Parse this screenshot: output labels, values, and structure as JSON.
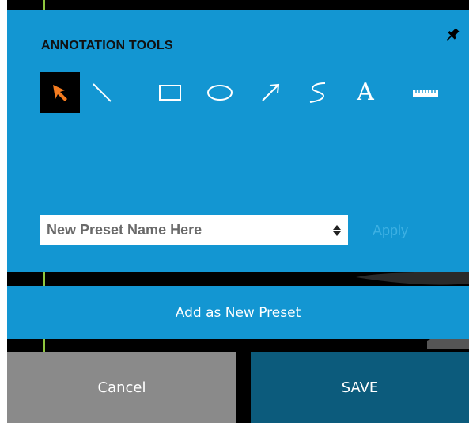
{
  "panel": {
    "title": "ANNOTATION TOOLS",
    "pin_icon": "pin-icon",
    "tools": [
      {
        "name": "pointer",
        "icon": "arrow-pointer-icon",
        "active": true
      },
      {
        "name": "line",
        "icon": "line-icon",
        "active": false
      },
      {
        "name": "rectangle",
        "icon": "rectangle-icon",
        "active": false
      },
      {
        "name": "ellipse",
        "icon": "ellipse-icon",
        "active": false
      },
      {
        "name": "arrow",
        "icon": "arrow-icon",
        "active": false
      },
      {
        "name": "freehand",
        "icon": "freehand-icon",
        "active": false
      },
      {
        "name": "text",
        "icon": "text-icon",
        "glyph": "A",
        "active": false
      },
      {
        "name": "ruler",
        "icon": "ruler-icon",
        "active": false
      }
    ]
  },
  "preset": {
    "placeholder": "New Preset Name Here",
    "apply_label": "Apply"
  },
  "add_preset_label": "Add as New Preset",
  "footer": {
    "cancel_label": "Cancel",
    "save_label": "SAVE"
  },
  "colors": {
    "panel_bg": "#1396d2",
    "active_tool_bg": "#000000",
    "pointer_accent": "#f47c20",
    "cancel_bg": "#8a8a8a",
    "save_bg": "#0c5b7c",
    "apply_text": "#3cb0e3"
  }
}
